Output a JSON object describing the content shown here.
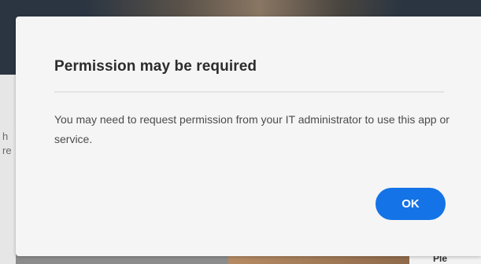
{
  "background": {
    "left_fragments": [
      "h",
      "re"
    ],
    "bottom_right_text": "Ple"
  },
  "dialog": {
    "title": "Permission may be required",
    "message": "You may need to request permission from your IT administrator to use this app or service.",
    "ok_label": "OK"
  },
  "colors": {
    "accent": "#1473e6",
    "dialog_background": "#f5f5f5",
    "title_text": "#2c2c2c",
    "body_text": "#4b4b4b"
  }
}
